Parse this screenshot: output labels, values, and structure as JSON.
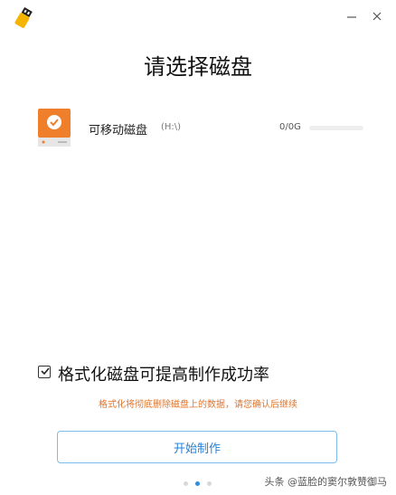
{
  "window": {
    "minimize_icon": "minimize-icon",
    "close_icon": "close-icon",
    "logo_icon": "usb-drive-icon"
  },
  "page": {
    "title": "请选择磁盘"
  },
  "disks": [
    {
      "name": "可移动磁盘",
      "letter": "(H:\\)",
      "capacity": "0/0G",
      "usage_fraction": 0,
      "icon": "check-disk-icon",
      "selected": true
    }
  ],
  "format_option": {
    "label": "格式化磁盘可提高制作成功率",
    "checked": true
  },
  "warning": "格式化将彻底删除磁盘上的数据，请您确认后继续",
  "start_button": "开始制作",
  "pager": {
    "pages": 3,
    "current": 2
  },
  "watermark": "头条 @蓝脸的窦尔敦赞御马",
  "colors": {
    "accent": "#2e8ee0",
    "warning": "#e0752c",
    "disk_orange": "#f07f2c"
  }
}
